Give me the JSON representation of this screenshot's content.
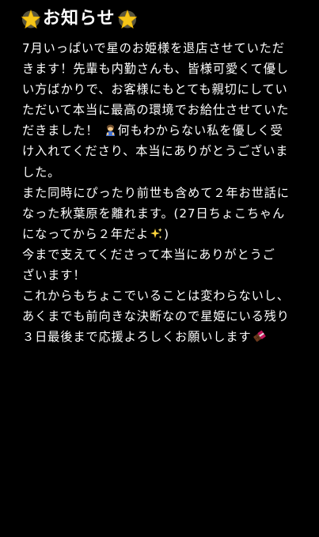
{
  "note": {
    "title": "お知らせ",
    "title_icon": "glowing-star",
    "lines": [
      "7月いっぱいで星のお姫様を退店させていただ",
      "きます！先輩も内勤さんも、皆様可愛くて優し",
      "い方ばかりで、お客様にもとても親切にしてい",
      "ただいて本当に最高の環境でお給仕させていた",
      "だきました！",
      "何もわからない私を優しく受",
      "け入れてくださり、本当にありがとうございま",
      "した。",
      "また同時にぴったり前世も含めて２年お世話に",
      "なった秋葉原を離れます。(27日ちょこちゃん",
      "になってから２年だよ",
      ")",
      "今まで支えてくださって本当にありがとうご",
      "ざいます！",
      "これからもちょこでいることは変わらないし、",
      "あくまでも前向きな決断なので星姫にいる残り",
      "３日最後まで応援よろしくお願いします"
    ],
    "icons": {
      "bow": "person-bowing",
      "sparkles": "sparkles",
      "chocolate": "chocolate-bar"
    }
  },
  "colors": {
    "background": "#000000",
    "text": "#ffffff",
    "star": "#f5c518"
  }
}
